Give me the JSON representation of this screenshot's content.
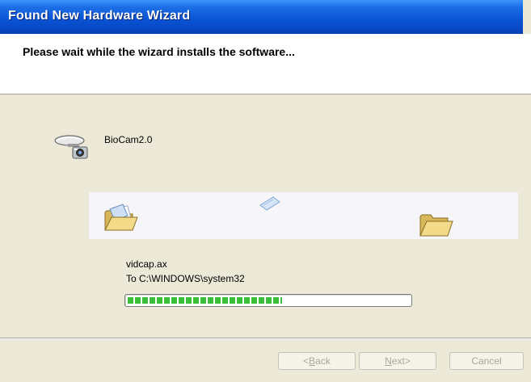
{
  "window": {
    "title": "Found New Hardware Wizard"
  },
  "header": {
    "heading": "Please wait while the wizard installs the software..."
  },
  "device": {
    "name": "BioCam2.0",
    "icon": "webcam-icon"
  },
  "copy": {
    "file_name": "vidcap.ax",
    "destination": "To C:\\WINDOWS\\system32",
    "progress": 0.55,
    "source_icon": "open-folder-icon",
    "target_icon": "open-folder-icon",
    "moving_icon": "flying-paper-icon"
  },
  "buttons": {
    "back": {
      "mnemonic": "B",
      "rest": "ack",
      "prefix": "< ",
      "enabled": false
    },
    "next": {
      "mnemonic": "N",
      "rest": "ext",
      "suffix": " >",
      "enabled": false
    },
    "cancel": {
      "label": "Cancel",
      "enabled": false
    }
  },
  "colors": {
    "title_bar": "#0A55D6",
    "progress_fill": "#3BBF3B",
    "dialog_bg": "#ECE9D8"
  }
}
